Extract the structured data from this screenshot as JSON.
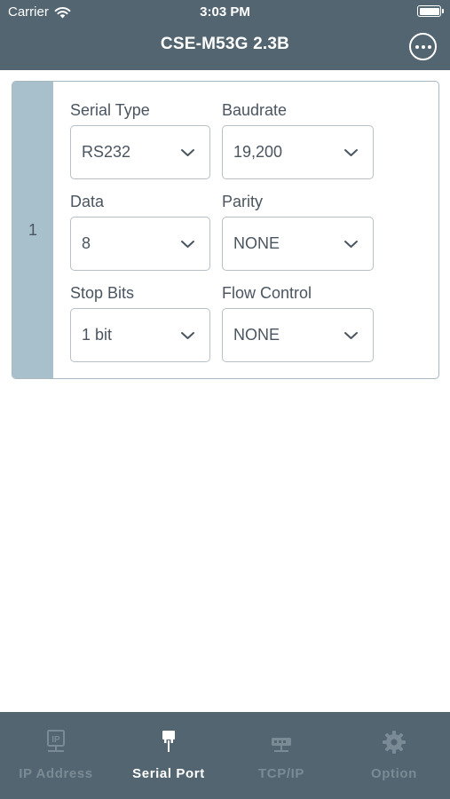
{
  "status_bar": {
    "carrier": "Carrier",
    "time": "3:03 PM"
  },
  "nav": {
    "title": "CSE-M53G 2.3B",
    "more_icon": "ellipsis-circle-icon"
  },
  "port": {
    "index": "1",
    "fields": {
      "serial_type": {
        "label": "Serial Type",
        "value": "RS232"
      },
      "baudrate": {
        "label": "Baudrate",
        "value": "19,200"
      },
      "data": {
        "label": "Data",
        "value": "8"
      },
      "parity": {
        "label": "Parity",
        "value": "NONE"
      },
      "stop_bits": {
        "label": "Stop Bits",
        "value": "1 bit"
      },
      "flow_control": {
        "label": "Flow Control",
        "value": "NONE"
      }
    }
  },
  "tabs": [
    {
      "label": "IP Address",
      "icon": "ip-address-icon",
      "active": false
    },
    {
      "label": "Serial Port",
      "icon": "serial-port-icon",
      "active": true
    },
    {
      "label": "TCP/IP",
      "icon": "tcp-ip-icon",
      "active": false
    },
    {
      "label": "Option",
      "icon": "gear-icon",
      "active": false
    }
  ],
  "colors": {
    "bar": "#536570",
    "index_column": "#a8c0cc",
    "text": "#4a5560",
    "inactive_tab": "#7a8b96"
  }
}
